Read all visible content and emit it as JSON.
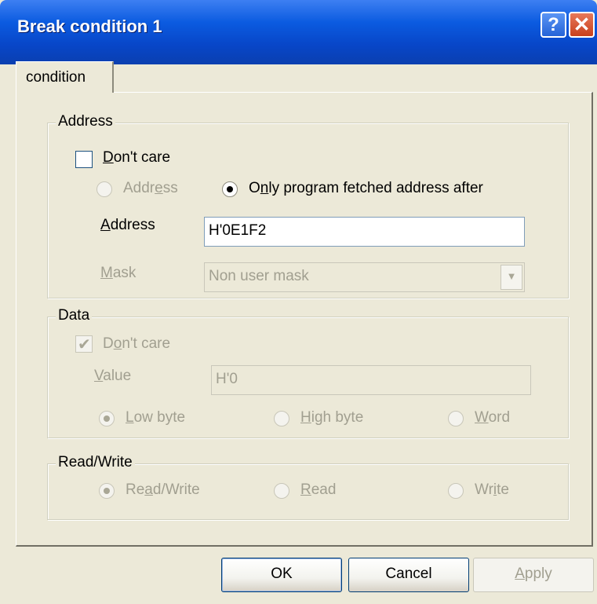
{
  "window": {
    "title": "Break condition 1",
    "help_glyph": "?",
    "close_glyph": "✕"
  },
  "tab": {
    "label": "condition"
  },
  "address_group": {
    "label": "Address",
    "dont_care": {
      "label_u": "D",
      "label_rest": "on't care",
      "checked": false
    },
    "radio_address": {
      "label_a": "Addr",
      "label_u": "e",
      "label_b": "ss",
      "selected": false,
      "enabled": false
    },
    "radio_fetched": {
      "label_a": "O",
      "label_u": "n",
      "label_b": "ly program fetched address after",
      "selected": true
    },
    "address_label_u": "A",
    "address_label_rest": "ddress",
    "address_value": "H'0E1F2",
    "mask_label_u": "M",
    "mask_label_rest": "ask",
    "mask_value": "Non user mask"
  },
  "data_group": {
    "label": "Data",
    "dont_care": {
      "label_u": "o",
      "label_a": "D",
      "label_b": "n't care",
      "checked": true,
      "enabled": false
    },
    "value_label_u": "V",
    "value_label_rest": "alue",
    "value": "H'0",
    "low_byte": {
      "label_u": "L",
      "label_rest": "ow byte",
      "selected": true
    },
    "high_byte": {
      "label_u": "H",
      "label_rest": "igh byte",
      "selected": false
    },
    "word": {
      "label_u": "W",
      "label_rest": "ord",
      "selected": false
    }
  },
  "rw_group": {
    "label": "Read/Write",
    "read_write": {
      "label_a": "Re",
      "label_u": "a",
      "label_b": "d/Write",
      "selected": true
    },
    "read": {
      "label_u": "R",
      "label_rest": "ead",
      "selected": false
    },
    "write": {
      "label_a": "Wr",
      "label_u": "i",
      "label_b": "te",
      "selected": false
    }
  },
  "buttons": {
    "ok": "OK",
    "cancel": "Cancel",
    "apply_u": "A",
    "apply_rest": "pply"
  },
  "colors": {
    "titlebar": "#0b5be0",
    "face": "#ece9d8",
    "disabled_text": "#a19f90"
  }
}
